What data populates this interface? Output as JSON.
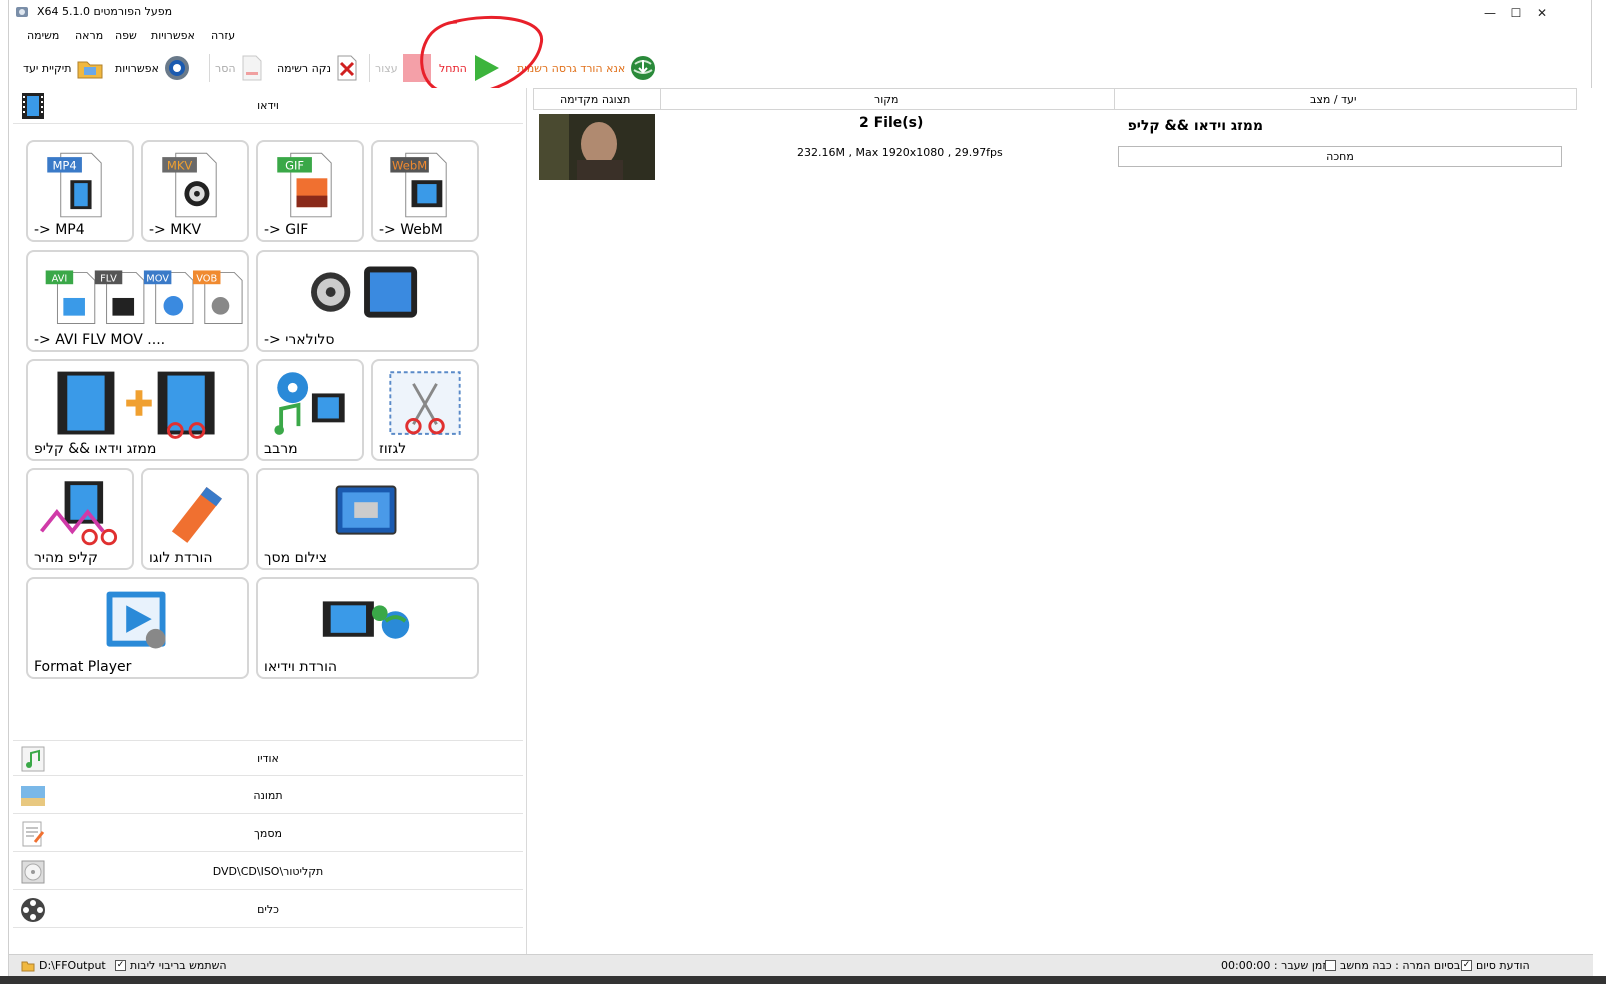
{
  "window": {
    "title": "X64 5.1.0 מפעל הפורמטים",
    "controls": {
      "minimize": "—",
      "maximize": "☐",
      "close": "✕"
    }
  },
  "menu": [
    "משימה",
    "מראה",
    "שפה",
    "אפשרויות",
    "עזרה"
  ],
  "toolbar": {
    "output_folder": "תיקיית יעד",
    "options": "אפשרויות",
    "remove": "הסר",
    "clear_list": "נקה רשימה",
    "stop": "עצור",
    "start": "התחל",
    "download": "אנא הורד גרסה רשמית"
  },
  "left": {
    "video_category": "וידאו",
    "tiles": [
      {
        "label": "-> MP4",
        "badge": "MP4"
      },
      {
        "label": "-> MKV",
        "badge": "MKV"
      },
      {
        "label": "-> GIF",
        "badge": "GIF"
      },
      {
        "label": "-> WebM",
        "badge": "WebM"
      },
      {
        "label": "-> AVI FLV MOV ....",
        "badges": [
          "AVI",
          "FLV",
          "MOV",
          "VOB"
        ]
      },
      {
        "label": "סלולארי <-"
      },
      {
        "label": "ממזג וידאו && קליפ"
      },
      {
        "label": "מרבב"
      },
      {
        "label": "לגזוז"
      },
      {
        "label": "קליפ מהיר"
      },
      {
        "label": "הורדת לוגו"
      },
      {
        "label": "צילום מסך"
      },
      {
        "label": "Format Player"
      },
      {
        "label": "הורדת וידיאו"
      }
    ],
    "categories": [
      "אודיו",
      "תמונה",
      "מסמך",
      "DVD\\CD\\ISO\\תקליטור",
      "כלים"
    ]
  },
  "grid": {
    "headers": {
      "preview": "תצוגה מקדימה",
      "source": "מקור",
      "dest_status": "יעד / מצב"
    },
    "row": {
      "files": "2 File(s)",
      "info": "232.16M , Max 1920x1080 , 29.97fps",
      "dest": "ממזג וידאו && קליפ",
      "status": "מחכה"
    }
  },
  "status": {
    "output_path": "D:\\FFOutput",
    "multithread": "השתמש בריבוי ליבות",
    "elapsed": "זמן שעבר : 00:00:00",
    "after_convert": "בסיום המרה : כבה מחשב",
    "notify": "הודעת סיום"
  },
  "colors": {
    "start_green": "#3cb43c",
    "annotation_red": "#e8202a",
    "download_orange": "#e0701a",
    "stop_pink": "#f4a0a8"
  }
}
